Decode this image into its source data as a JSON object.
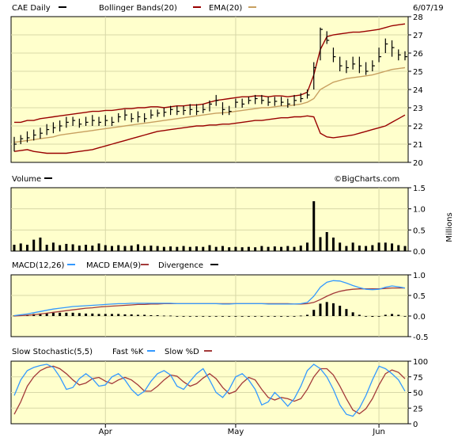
{
  "header": {
    "symbol_label": "CAE Daily",
    "bollinger_label": "Bollinger Bands(20)",
    "ema_label": "EMA(20)",
    "date": "6/07/19"
  },
  "colors": {
    "panel_bg": "#ffffcc",
    "grid": "#d8d8a8",
    "price": "#000000",
    "bollinger": "#990000",
    "ema": "#c8a060",
    "macd": "#3399ff",
    "macd_ema": "#a33a3a",
    "divergence": "#000000",
    "volume": "#000000",
    "fast_k": "#3399ff",
    "slow_d": "#a33a3a"
  },
  "volume_panel": {
    "title": "Volume",
    "watermark": "©BigCharts.com",
    "unit": "Millions"
  },
  "macd_panel": {
    "macd_label": "MACD(12,26)",
    "macd_ema_label": "MACD EMA(9)",
    "divergence_label": "Divergence"
  },
  "stoch_panel": {
    "title": "Slow Stochastic(5,5)",
    "fast_label": "Fast %K",
    "slow_label": "Slow %D"
  },
  "x_axis_labels": [
    "Apr",
    "May",
    "Jun"
  ],
  "chart_data": [
    {
      "type": "ohlc",
      "title": "CAE Daily",
      "ylim": [
        20,
        28
      ],
      "yticks": [
        20,
        21,
        22,
        23,
        24,
        25,
        26,
        27,
        28
      ],
      "close": [
        21.0,
        21.3,
        21.35,
        21.5,
        21.6,
        21.8,
        21.9,
        22.0,
        22.2,
        22.3,
        22.1,
        22.2,
        22.3,
        22.2,
        22.3,
        22.2,
        22.5,
        22.6,
        22.4,
        22.5,
        22.4,
        22.6,
        22.7,
        22.75,
        22.9,
        22.8,
        22.85,
        22.9,
        22.8,
        22.9,
        23.2,
        23.4,
        22.9,
        22.8,
        23.3,
        23.2,
        23.4,
        23.5,
        23.4,
        23.3,
        23.35,
        23.3,
        23.2,
        23.4,
        23.5,
        23.7,
        25.2,
        27.3,
        26.7,
        25.8,
        25.3,
        25.2,
        25.4,
        25.3,
        25.0,
        25.3,
        25.8,
        26.5,
        26.3,
        25.9,
        25.8
      ],
      "high": [
        21.4,
        21.5,
        21.7,
        21.8,
        21.9,
        22.1,
        22.2,
        22.3,
        22.5,
        22.5,
        22.4,
        22.5,
        22.6,
        22.5,
        22.6,
        22.5,
        22.7,
        22.9,
        22.7,
        22.8,
        22.7,
        22.9,
        22.9,
        23.0,
        23.1,
        23.1,
        23.1,
        23.2,
        23.2,
        23.2,
        23.4,
        23.7,
        23.3,
        23.1,
        23.5,
        23.5,
        23.6,
        23.7,
        23.7,
        23.6,
        23.6,
        23.6,
        23.5,
        23.7,
        23.8,
        24.0,
        25.5,
        27.4,
        27.2,
        26.3,
        25.8,
        25.6,
        25.8,
        25.8,
        25.5,
        25.6,
        26.3,
        26.8,
        26.7,
        26.2,
        26.1
      ],
      "low": [
        20.6,
        21.0,
        21.1,
        21.2,
        21.3,
        21.5,
        21.6,
        21.7,
        21.9,
        22.0,
        21.9,
        22.0,
        22.0,
        22.0,
        22.0,
        22.0,
        22.2,
        22.3,
        22.2,
        22.2,
        22.2,
        22.4,
        22.5,
        22.5,
        22.6,
        22.6,
        22.6,
        22.6,
        22.6,
        22.7,
        22.8,
        23.1,
        22.6,
        22.6,
        23.0,
        23.0,
        23.2,
        23.2,
        23.2,
        23.1,
        23.1,
        23.1,
        23.0,
        23.1,
        23.3,
        23.5,
        24.0,
        25.6,
        26.5,
        25.5,
        25.0,
        24.9,
        25.1,
        24.9,
        24.8,
        25.0,
        25.5,
        26.0,
        25.8,
        25.6,
        25.6
      ],
      "bollinger_upper": [
        22.2,
        22.2,
        22.3,
        22.3,
        22.4,
        22.45,
        22.5,
        22.55,
        22.6,
        22.65,
        22.7,
        22.75,
        22.8,
        22.8,
        22.85,
        22.85,
        22.9,
        22.95,
        22.95,
        23.0,
        23.0,
        23.05,
        23.05,
        23.0,
        23.05,
        23.1,
        23.1,
        23.15,
        23.15,
        23.2,
        23.3,
        23.4,
        23.45,
        23.5,
        23.55,
        23.6,
        23.6,
        23.65,
        23.65,
        23.6,
        23.65,
        23.65,
        23.6,
        23.65,
        23.7,
        23.85,
        24.8,
        26.2,
        26.9,
        27.0,
        27.05,
        27.1,
        27.15,
        27.15,
        27.2,
        27.25,
        27.3,
        27.4,
        27.5,
        27.55,
        27.6
      ],
      "bollinger_lower": [
        20.6,
        20.65,
        20.7,
        20.6,
        20.55,
        20.5,
        20.5,
        20.5,
        20.5,
        20.55,
        20.6,
        20.65,
        20.7,
        20.8,
        20.9,
        21.0,
        21.1,
        21.2,
        21.3,
        21.4,
        21.5,
        21.6,
        21.7,
        21.75,
        21.8,
        21.85,
        21.9,
        21.95,
        22.0,
        22.0,
        22.05,
        22.05,
        22.1,
        22.1,
        22.15,
        22.2,
        22.25,
        22.3,
        22.3,
        22.35,
        22.4,
        22.45,
        22.45,
        22.5,
        22.5,
        22.55,
        22.5,
        21.6,
        21.4,
        21.35,
        21.4,
        21.45,
        21.5,
        21.6,
        21.7,
        21.8,
        21.9,
        22.0,
        22.2,
        22.4,
        22.6
      ],
      "ema": [
        21.1,
        21.15,
        21.2,
        21.25,
        21.3,
        21.35,
        21.4,
        21.5,
        21.55,
        21.6,
        21.65,
        21.7,
        21.75,
        21.8,
        21.85,
        21.9,
        21.95,
        22.0,
        22.05,
        22.1,
        22.15,
        22.2,
        22.25,
        22.3,
        22.35,
        22.4,
        22.45,
        22.5,
        22.55,
        22.6,
        22.65,
        22.7,
        22.72,
        22.75,
        22.8,
        22.85,
        22.9,
        22.95,
        23.0,
        23.0,
        23.05,
        23.1,
        23.1,
        23.15,
        23.2,
        23.3,
        23.5,
        24.0,
        24.2,
        24.4,
        24.5,
        24.6,
        24.65,
        24.7,
        24.75,
        24.8,
        24.9,
        25.0,
        25.1,
        25.15,
        25.2
      ]
    },
    {
      "type": "bar",
      "title": "Volume",
      "ylabel": "Millions",
      "ylim": [
        0,
        1.5
      ],
      "yticks": [
        0,
        0.5,
        1.0,
        1.5
      ],
      "values": [
        0.15,
        0.18,
        0.15,
        0.27,
        0.32,
        0.15,
        0.2,
        0.14,
        0.17,
        0.16,
        0.13,
        0.15,
        0.13,
        0.18,
        0.14,
        0.12,
        0.14,
        0.12,
        0.13,
        0.16,
        0.12,
        0.13,
        0.12,
        0.1,
        0.11,
        0.1,
        0.12,
        0.1,
        0.11,
        0.1,
        0.14,
        0.1,
        0.12,
        0.09,
        0.1,
        0.09,
        0.1,
        0.09,
        0.12,
        0.1,
        0.11,
        0.1,
        0.12,
        0.1,
        0.13,
        0.2,
        1.18,
        0.33,
        0.45,
        0.32,
        0.2,
        0.12,
        0.2,
        0.13,
        0.12,
        0.14,
        0.2,
        0.2,
        0.18,
        0.14,
        0.12
      ]
    },
    {
      "type": "line",
      "title": "MACD(12,26)",
      "ylim": [
        -0.5,
        1.0
      ],
      "yticks": [
        -0.5,
        0,
        0.5,
        1.0
      ],
      "series": [
        {
          "name": "MACD(12,26)",
          "values": [
            0.01,
            0.03,
            0.05,
            0.08,
            0.11,
            0.14,
            0.17,
            0.19,
            0.21,
            0.23,
            0.24,
            0.25,
            0.26,
            0.27,
            0.28,
            0.29,
            0.3,
            0.3,
            0.31,
            0.31,
            0.31,
            0.31,
            0.31,
            0.31,
            0.31,
            0.3,
            0.3,
            0.3,
            0.3,
            0.3,
            0.3,
            0.3,
            0.29,
            0.29,
            0.3,
            0.3,
            0.3,
            0.3,
            0.3,
            0.29,
            0.29,
            0.29,
            0.29,
            0.29,
            0.3,
            0.33,
            0.48,
            0.7,
            0.82,
            0.86,
            0.85,
            0.8,
            0.74,
            0.69,
            0.65,
            0.64,
            0.65,
            0.7,
            0.73,
            0.71,
            0.68
          ]
        },
        {
          "name": "MACD EMA(9)",
          "values": [
            0.0,
            0.01,
            0.02,
            0.03,
            0.05,
            0.07,
            0.09,
            0.11,
            0.13,
            0.15,
            0.17,
            0.19,
            0.2,
            0.22,
            0.23,
            0.24,
            0.25,
            0.26,
            0.27,
            0.28,
            0.28,
            0.29,
            0.29,
            0.3,
            0.3,
            0.3,
            0.3,
            0.3,
            0.3,
            0.3,
            0.3,
            0.3,
            0.3,
            0.3,
            0.3,
            0.3,
            0.3,
            0.3,
            0.3,
            0.3,
            0.3,
            0.3,
            0.3,
            0.29,
            0.29,
            0.3,
            0.33,
            0.4,
            0.48,
            0.55,
            0.6,
            0.63,
            0.65,
            0.66,
            0.66,
            0.66,
            0.66,
            0.67,
            0.68,
            0.68,
            0.68
          ]
        },
        {
          "name": "Divergence",
          "values": [
            0.01,
            0.02,
            0.03,
            0.05,
            0.06,
            0.07,
            0.08,
            0.08,
            0.08,
            0.08,
            0.07,
            0.06,
            0.06,
            0.05,
            0.05,
            0.05,
            0.05,
            0.04,
            0.04,
            0.03,
            0.03,
            0.02,
            0.02,
            0.01,
            0.01,
            0.0,
            0.0,
            0.0,
            0.0,
            0.0,
            0.0,
            0.0,
            -0.01,
            -0.01,
            0.0,
            0.0,
            0.0,
            0.0,
            0.0,
            -0.01,
            -0.01,
            -0.01,
            -0.01,
            0.0,
            0.01,
            0.03,
            0.15,
            0.3,
            0.34,
            0.31,
            0.25,
            0.17,
            0.09,
            0.03,
            -0.01,
            -0.02,
            -0.01,
            0.03,
            0.05,
            0.03,
            0.0
          ]
        }
      ]
    },
    {
      "type": "line",
      "title": "Slow Stochastic(5,5)",
      "ylim": [
        0,
        100
      ],
      "yticks": [
        0,
        25,
        50,
        75,
        100
      ],
      "series": [
        {
          "name": "Fast %K",
          "values": [
            45,
            70,
            85,
            90,
            93,
            95,
            90,
            75,
            55,
            58,
            72,
            80,
            72,
            60,
            62,
            75,
            80,
            70,
            55,
            45,
            52,
            68,
            80,
            85,
            78,
            60,
            55,
            68,
            80,
            88,
            70,
            50,
            42,
            55,
            75,
            80,
            70,
            55,
            30,
            35,
            50,
            40,
            28,
            40,
            60,
            85,
            95,
            88,
            75,
            55,
            30,
            15,
            12,
            25,
            45,
            70,
            92,
            88,
            80,
            70,
            52
          ]
        },
        {
          "name": "Slow %D",
          "values": [
            15,
            35,
            60,
            75,
            85,
            90,
            92,
            88,
            80,
            70,
            62,
            65,
            72,
            74,
            68,
            64,
            70,
            74,
            70,
            62,
            52,
            52,
            60,
            70,
            78,
            76,
            67,
            60,
            64,
            73,
            80,
            72,
            58,
            48,
            52,
            65,
            74,
            70,
            55,
            42,
            38,
            42,
            40,
            36,
            40,
            55,
            75,
            88,
            88,
            78,
            60,
            40,
            22,
            16,
            24,
            40,
            62,
            80,
            86,
            82,
            72
          ]
        }
      ]
    }
  ]
}
